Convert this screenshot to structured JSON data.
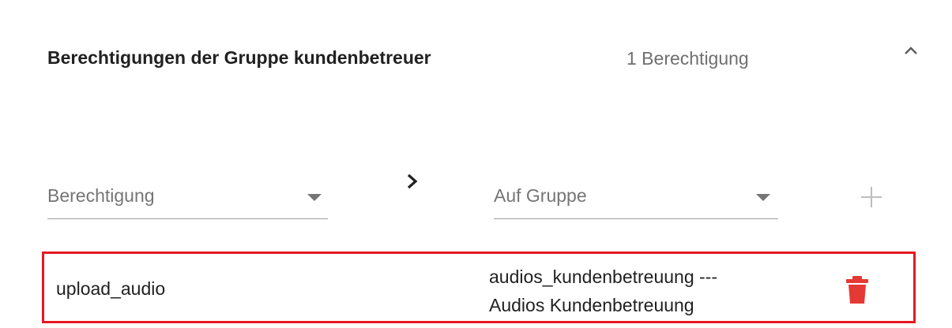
{
  "header": {
    "title": "Berechtigungen der Gruppe kundenbetreuer",
    "count": "1 Berechtigung"
  },
  "form": {
    "permission_placeholder": "Berechtigung",
    "group_placeholder": "Auf Gruppe"
  },
  "permissions": [
    {
      "name": "upload_audio",
      "group_line1": "audios_kundenbetreuung ---",
      "group_line2": "Audios Kundenbetreuung"
    }
  ],
  "colors": {
    "accent_red": "#e53935",
    "highlight_border": "#e21a22",
    "muted_text": "#757575"
  },
  "icons": [
    "chevron-up-icon",
    "chevron-right-icon",
    "dropdown-arrow-icon",
    "plus-icon",
    "trash-icon"
  ]
}
